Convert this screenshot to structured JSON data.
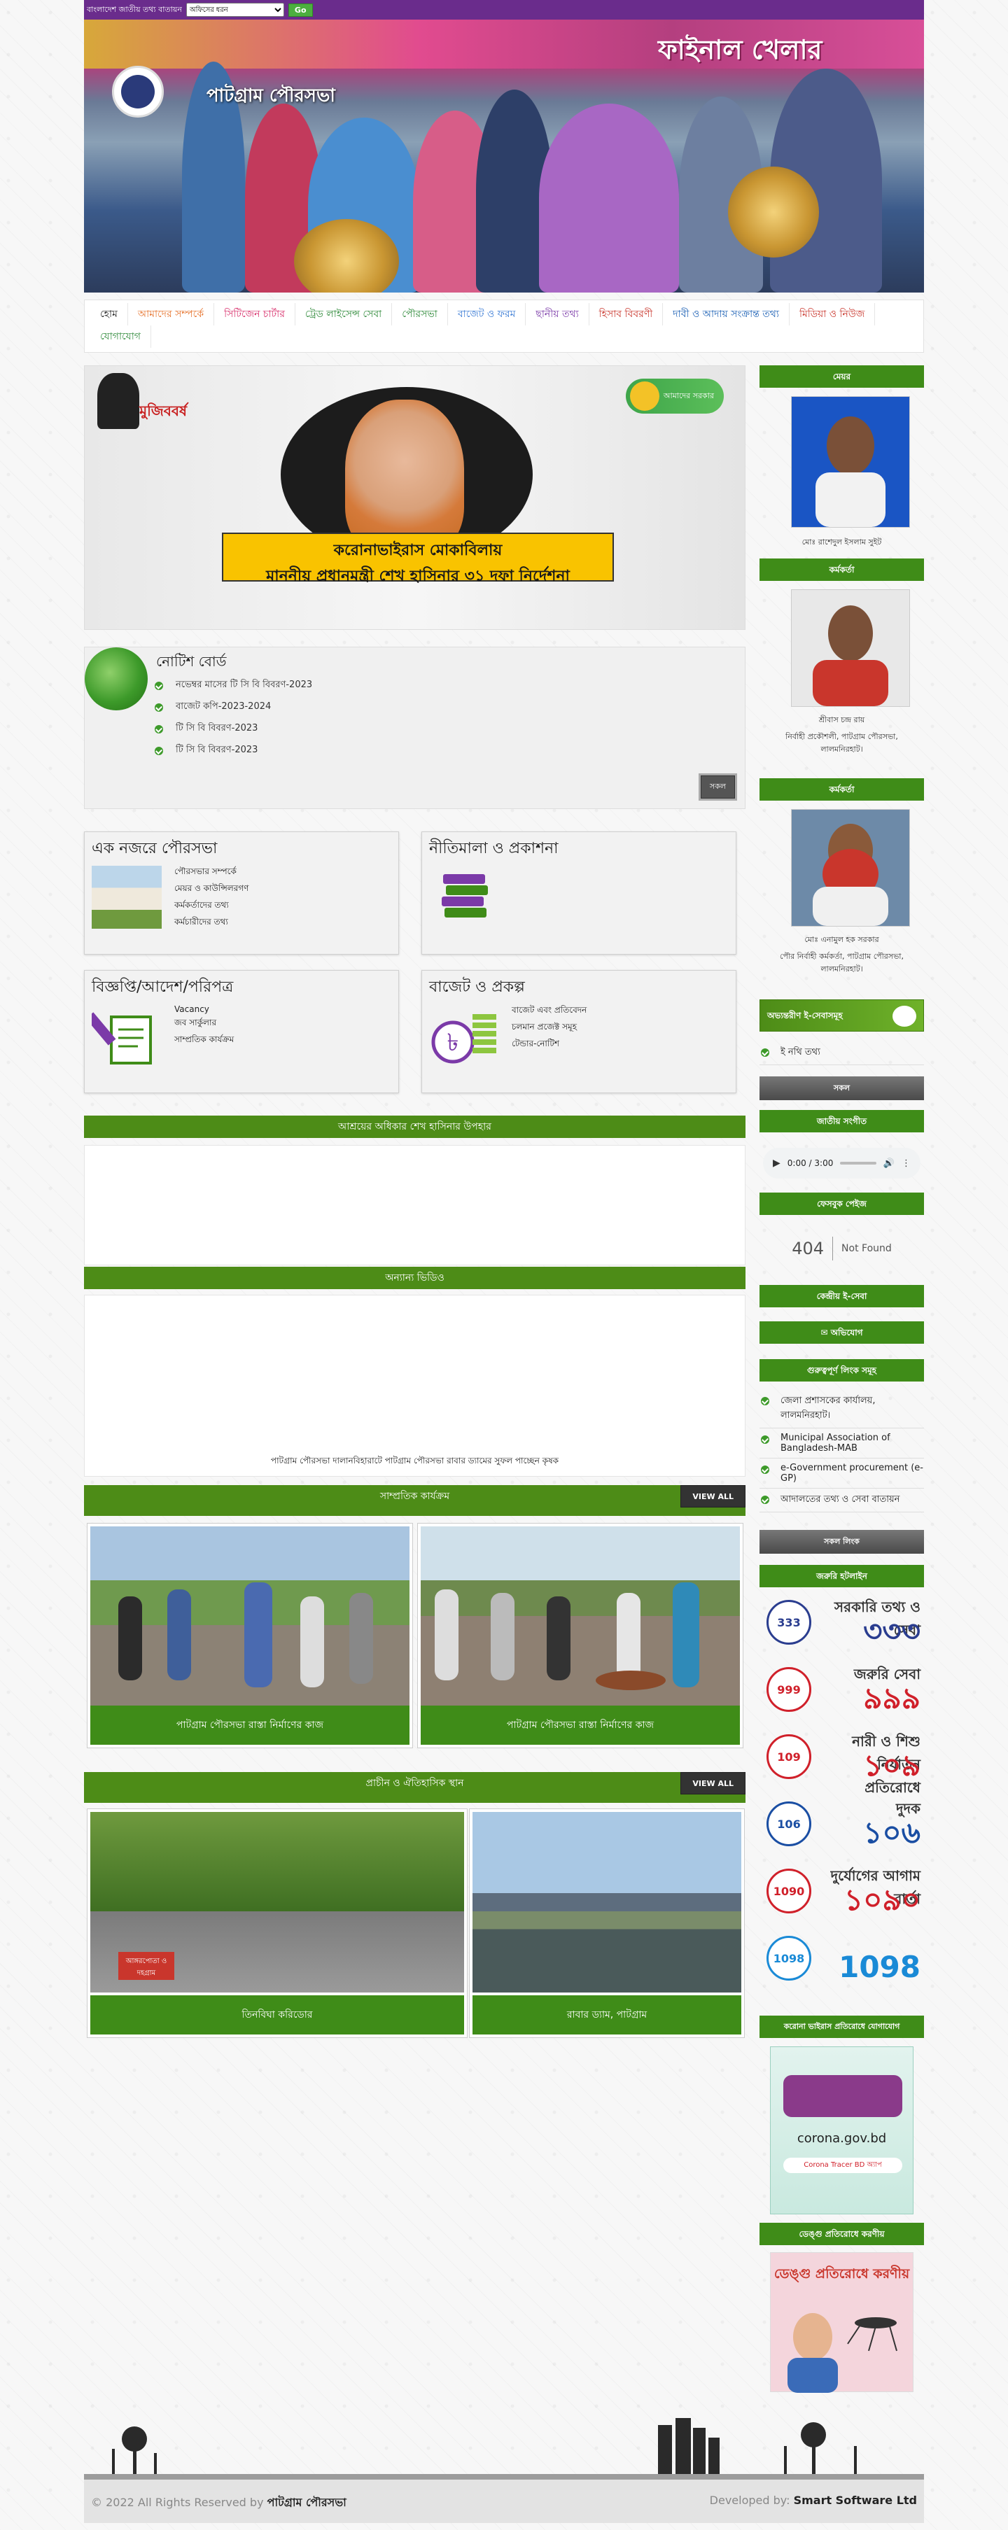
{
  "topbar": {
    "site_name": "বাংলাদেশ জাতীয় তথ্য বাতায়ন",
    "select_value": "অফিসের ধরন",
    "go_label": "Go"
  },
  "banner": {
    "title": "পাটগ্রাম পৌরসভা",
    "sign_text": "ফাইনাল খেলার"
  },
  "nav": {
    "items": [
      {
        "label": "হোম",
        "color": "#222222"
      },
      {
        "label": "আমাদের সম্পর্কে",
        "color": "#e6722b"
      },
      {
        "label": "সিটিজেন চার্টার",
        "color": "#d82f6b"
      },
      {
        "label": "ট্রেড লাইসেন্স সেবা",
        "color": "#2f8a3a"
      },
      {
        "label": "পৌরসভা",
        "color": "#2f8a3a"
      },
      {
        "label": "বাজেট ও ফরম",
        "color": "#3a7bd5"
      },
      {
        "label": "ছানীয় তথ্য",
        "color": "#7b3aa8"
      },
      {
        "label": "হিসাব বিবরণী",
        "color": "#c9362c"
      },
      {
        "label": "দাবী ও আদায় সংক্রান্ত তথ্য",
        "color": "#1a5fb4"
      },
      {
        "label": "মিডিয়া ও নিউজ",
        "color": "#c9362c"
      },
      {
        "label": "যোগাযোগ",
        "color": "#2f8a3a"
      }
    ]
  },
  "slider": {
    "line1": "করোনাভাইরাস মোকাবিলায়",
    "line2": "মাননীয় প্রধানমন্ত্রী শেখ হাসিনার ৩১ দফা নির্দেশনা",
    "mujib_text": "মুজিববর্ষ",
    "sun_text": "আমাদের সরকার"
  },
  "notice": {
    "title": "নোটিশ বোর্ড",
    "items": [
      "নভেম্বর মাসের টি সি বি বিবরণ-2023",
      "বাজেট কপি-2023-2024",
      "টি সি বি বিবরণ-2023",
      "টি সি বি বিবরণ-2023"
    ],
    "all_label": "সকল"
  },
  "boxes": [
    {
      "title": "এক নজরে পৌরসভা",
      "items": [
        "পৌরসভার সম্পর্কে",
        "মেয়র ও কাউন্সিলরগণ",
        "কর্মকর্তাদের তথ্য",
        "কর্মচারীদের তথ্য"
      ]
    },
    {
      "title": "নীতিমালা ও প্রকাশনা",
      "items": []
    },
    {
      "title": "বিজ্ঞপ্তি/আদেশ/পরিপত্র",
      "items": [
        "Vacancy",
        "জব সার্কুলার",
        "সাম্প্রতিক কার্যক্রম"
      ]
    },
    {
      "title": "বাজেট ও প্রকল্প",
      "items": [
        "বাজেট এবং প্রতিবেদন",
        "চলমান প্রজেক্ট সমূহ",
        "টেন্ডার-নোটিশ"
      ]
    }
  ],
  "sections": {
    "sheikh_hasina": "আশ্রয়ের অধিকার শেখ হাসিনার উপহার",
    "other_video": "অন্যান্য ভিডিও",
    "video_caption": "পাটগ্রাম পৌরসভা দালানবিহারাটে পাটগ্রাম পৌরসভা রাবার ড্যামের সুফল পাচ্ছেন কৃষক",
    "recent": "সাম্প্রতিক কার্যক্রম",
    "heritage": "প্রাচীন ও ঐতিহাসিক স্থান",
    "view_all": "VIEW ALL"
  },
  "recent_cards": [
    "পাটগ্রাম পৌরসভা রাস্তা নির্মাণের কাজ",
    "পাটগ্রাম পৌরসভা রাস্তা নির্মাণের কাজ"
  ],
  "heritage_cards": [
    "তিনবিঘা করিডোর",
    "রাবার ড্যাম, পাটগ্রাম"
  ],
  "heritage_sign": "আঙ্গরপোতা ও দহগ্রাম",
  "sidebar": {
    "mayor_head": "মেয়র",
    "mayor_name": "মোঃ রাশেদুল ইসলাম সুইট",
    "officer_head": "কর্মকর্তা",
    "officer1_name": "শ্রীবাস চন্দ্র রায়",
    "officer1_title": "নির্বাহী প্রকৌশলী, পাটগ্রাম পৌরসভা, লালমনিরহাট।",
    "officer2_head": "কর্মকর্তা",
    "officer2_name": "মোঃ এনামুল হক সরকার",
    "officer2_title": "পৌর নির্বাহী কর্মকর্তা, পাটগ্রাম পৌরসভা, লালমনিরহাট।",
    "eservice_label": "অভ্যন্তরীণ ই-সেবাসমূহ",
    "eservice_items": [
      "ই নথি তথ্য"
    ],
    "all_label": "সকল",
    "anthem_head": "জাতীয় সংগীত",
    "audio_time": "0:00 / 3:00",
    "facebook_head": "ফেসবুক পেইজ",
    "fb_404": "404",
    "fb_notfound": "Not Found",
    "central_head": "কেন্দ্রীয় ই-সেবা",
    "complaint_label": "অভিযোগ",
    "links_head": "গুরুত্বপূর্ণ লিংক সমূহ",
    "links": [
      "জেলা প্রশাসকের কার্যালয়, লালমনিরহাট।",
      "Municipal Association of Bangladesh-MAB",
      "e-Government procurement (e-GP)",
      "আদালতের তথ্য ও সেবা বাতায়ন"
    ],
    "all_links_label": "সকল লিংক",
    "hotline_head": "জরুরি হটলাইন",
    "corona_head": "করোনা ভাইরাস প্রতিরোধে যোগাযোগ",
    "corona_site": "corona.gov.bd",
    "corona_app": "Corona Tracer BD অ্যাপ",
    "dengue_head": "ডেঙ্গু প্রতিরোধে করণীয়",
    "dengue_img_text": "ডেঙ্গু প্রতিরোধে করণীয়"
  },
  "hotlines": [
    {
      "small": "সরকারি তথ্য ও সেবা",
      "big": "৩৩৩",
      "icon": "333",
      "color": "#2a3d8f"
    },
    {
      "small": "জরুরি সেবা",
      "big": "৯৯৯",
      "icon": "999",
      "color": "#d0202a"
    },
    {
      "small": "নারী ও শিশু নির্যাতন প্রতিরোধে",
      "big": "১০৯",
      "icon": "109",
      "color": "#d0202a"
    },
    {
      "small": "দুদক",
      "big": "১০৬",
      "icon": "106",
      "color": "#1a4ea3"
    },
    {
      "small": "দুর্যোগের আগাম বার্তা",
      "big": "১০৯০",
      "icon": "1090",
      "color": "#d0202a"
    },
    {
      "small": "",
      "big": "1098",
      "icon": "1098",
      "color": "#1a8ad6"
    }
  ],
  "footer": {
    "copyright": "© 2022 All Rights Reserved by",
    "org": "পাটগ্রাম পৌরসভা",
    "dev_label": "Developed by:",
    "dev_org": "Smart Software Ltd"
  }
}
